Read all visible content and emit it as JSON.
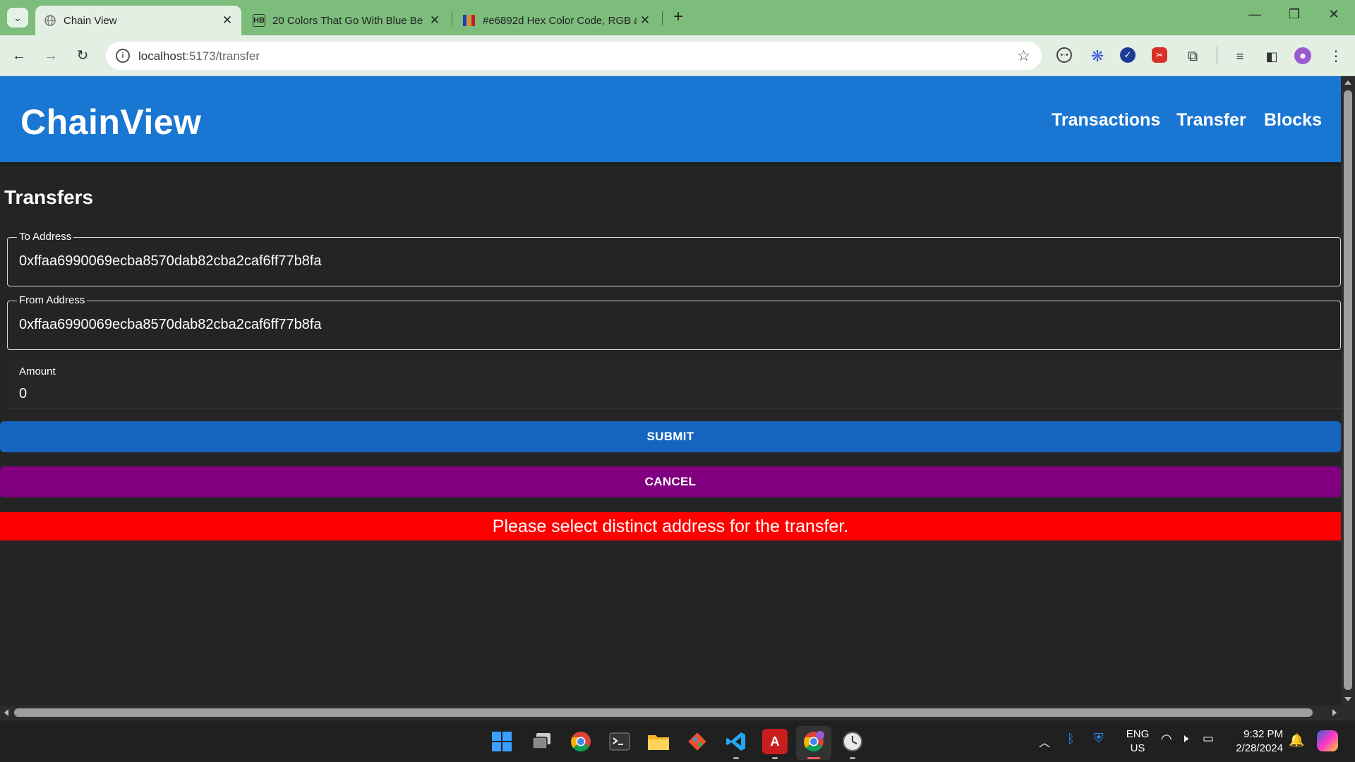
{
  "browser": {
    "tabs": [
      {
        "title": "Chain View",
        "favicon": "globe-icon",
        "active": true
      },
      {
        "title": "20 Colors That Go With Blue Be",
        "favicon": "HB"
      },
      {
        "title": "#e6892d Hex Color Code, RGB a",
        "favicon": "palette-icon"
      }
    ],
    "url_host": "localhost",
    "url_rest": ":5173/transfer",
    "new_tab": "+",
    "close_glyph": "✕"
  },
  "app": {
    "brand": "ChainView",
    "nav": [
      "Transactions",
      "Transfer",
      "Blocks"
    ],
    "header_color": "#1976d2"
  },
  "form": {
    "title": "Transfers",
    "to_label": "To Address",
    "to_value": "0xffaa6990069ecba8570dab82cba2caf6ff77b8fa",
    "from_label": "From Address",
    "from_value": "0xffaa6990069ecba8570dab82cba2caf6ff77b8fa",
    "amount_label": "Amount",
    "amount_value": "0",
    "submit": "SUBMIT",
    "cancel": "CANCEL",
    "error": "Please select distinct address for the transfer.",
    "submit_color": "#1565c0",
    "cancel_color": "#800080",
    "error_color": "#ff0000"
  },
  "taskbar": {
    "lang_top": "ENG",
    "lang_bottom": "US",
    "time": "9:32 PM",
    "date": "2/28/2024"
  }
}
